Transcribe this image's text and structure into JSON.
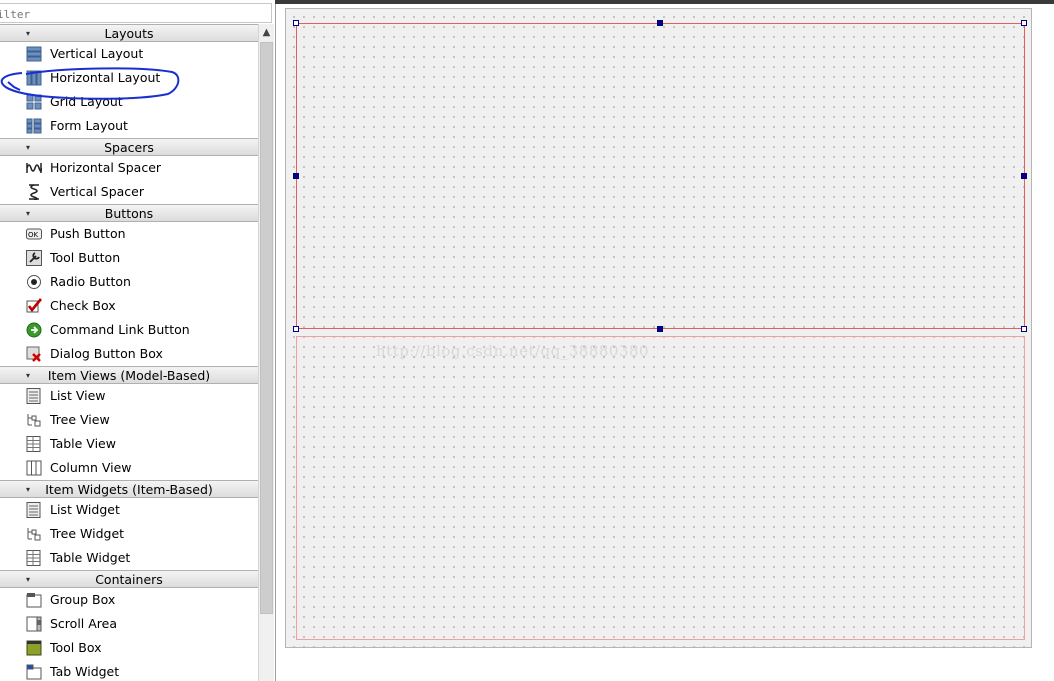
{
  "filter": {
    "placeholder": "ilter"
  },
  "categories": [
    {
      "name": "Layouts",
      "items": [
        {
          "label": "Vertical Layout",
          "icon": "vertical-layout-icon"
        },
        {
          "label": "Horizontal Layout",
          "icon": "horizontal-layout-icon"
        },
        {
          "label": "Grid Layout",
          "icon": "grid-layout-icon"
        },
        {
          "label": "Form Layout",
          "icon": "form-layout-icon"
        }
      ]
    },
    {
      "name": "Spacers",
      "items": [
        {
          "label": "Horizontal Spacer",
          "icon": "horizontal-spacer-icon"
        },
        {
          "label": "Vertical Spacer",
          "icon": "vertical-spacer-icon"
        }
      ]
    },
    {
      "name": "Buttons",
      "items": [
        {
          "label": "Push Button",
          "icon": "push-button-icon"
        },
        {
          "label": "Tool Button",
          "icon": "tool-button-icon"
        },
        {
          "label": "Radio Button",
          "icon": "radio-button-icon"
        },
        {
          "label": "Check Box",
          "icon": "check-box-icon"
        },
        {
          "label": "Command Link Button",
          "icon": "command-link-icon"
        },
        {
          "label": "Dialog Button Box",
          "icon": "dialog-button-box-icon"
        }
      ]
    },
    {
      "name": "Item Views (Model-Based)",
      "items": [
        {
          "label": "List View",
          "icon": "list-view-icon"
        },
        {
          "label": "Tree View",
          "icon": "tree-view-icon"
        },
        {
          "label": "Table View",
          "icon": "table-view-icon"
        },
        {
          "label": "Column View",
          "icon": "column-view-icon"
        }
      ]
    },
    {
      "name": "Item Widgets (Item-Based)",
      "items": [
        {
          "label": "List Widget",
          "icon": "list-widget-icon"
        },
        {
          "label": "Tree Widget",
          "icon": "tree-widget-icon"
        },
        {
          "label": "Table Widget",
          "icon": "table-widget-icon"
        }
      ]
    },
    {
      "name": "Containers",
      "items": [
        {
          "label": "Group Box",
          "icon": "group-box-icon"
        },
        {
          "label": "Scroll Area",
          "icon": "scroll-area-icon"
        },
        {
          "label": "Tool Box",
          "icon": "tool-box-icon"
        },
        {
          "label": "Tab Widget",
          "icon": "tab-widget-icon"
        }
      ]
    }
  ],
  "watermark": "http://blog.csdn.net/qq_38880380",
  "colors": {
    "layout_border": "#e06060",
    "selection_handle": "#000080",
    "annotation": "#1a2fd0"
  }
}
